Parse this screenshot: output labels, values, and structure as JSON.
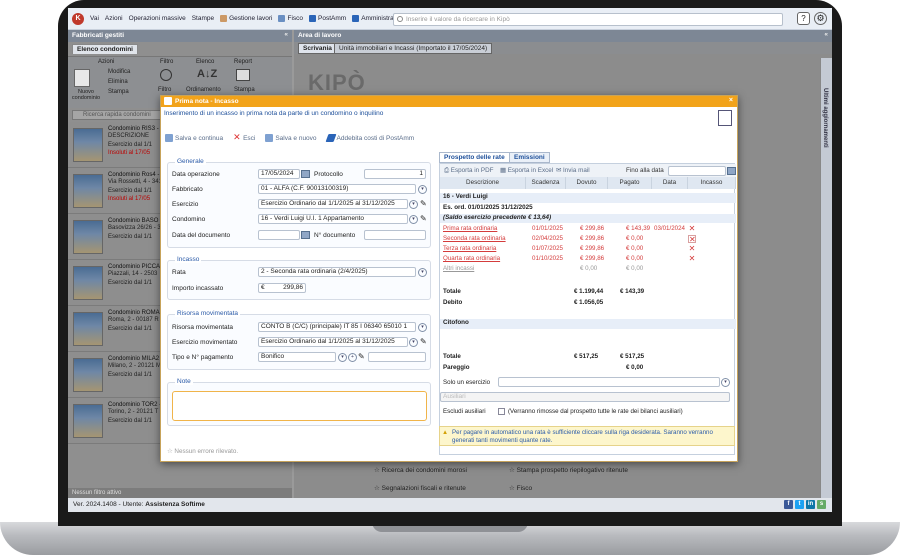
{
  "topbar": {
    "menu": [
      {
        "label": "Vai",
        "icon": "menu-icon"
      },
      {
        "label": "Azioni",
        "icon": "actions-icon"
      },
      {
        "label": "Operazioni massive",
        "icon": "bulk-icon"
      },
      {
        "label": "Stampe",
        "icon": "print-icon"
      },
      {
        "label": "Gestione lavori",
        "icon": "tools-icon"
      },
      {
        "label": "Fisco",
        "icon": "tax-icon"
      },
      {
        "label": "PostAmm",
        "icon": "postamm-icon"
      },
      {
        "label": "Amministrare.com",
        "icon": "web-icon"
      }
    ],
    "search_placeholder": "Inserire il valore da ricercare in Kipò",
    "help": "?",
    "settings": "⚙"
  },
  "left": {
    "title": "Fabbricati gestiti",
    "collapse": "«",
    "tab": "Elenco condomini",
    "toolbar": {
      "azioni": "Azioni",
      "nuovo": "Nuovo condominio",
      "modifica": "Modifica",
      "elimina": "Elimina",
      "stampa": "Stampa",
      "filtro": "Filtro",
      "filtro_btn": "Filtro",
      "elenco": "Elenco",
      "ordinamento": "Ordinamento",
      "report": "Report",
      "stampa_report": "Stampa"
    },
    "search_placeholder": "Ricerca rapida condomini",
    "condos": [
      {
        "name": "Condominio RIS3 -",
        "addr": "DESCRIZIONE",
        "extra": "Via Remondo, 3 - 2",
        "extra2": "C.F. 00843430023",
        "ex": "Esercizio dal 1/1",
        "ins": "Insoluti al 17/05"
      },
      {
        "name": "Condominio Ros4 -",
        "addr": "Via Rossetti, 4 - 341",
        "ex": "Esercizio dal 1/1",
        "ins": "Insoluti al 17/05"
      },
      {
        "name": "Condominio BASO",
        "addr": "Basovizza 26/26 - 3",
        "ex": "Esercizio dal 1/1",
        "ins": ""
      },
      {
        "name": "Condominio PICCA",
        "addr": "Piazzali, 14 - 2503",
        "ex": "Esercizio dal 1/1",
        "ins": ""
      },
      {
        "name": "Condominio ROMA",
        "addr": "Roma, 2 - 00187 R",
        "ex": "Esercizio dal 1/1",
        "ins": ""
      },
      {
        "name": "Condominio MILA2",
        "addr": "Milano, 2 - 20121 M",
        "ex": "Esercizio dal 1/1",
        "ins": ""
      },
      {
        "name": "Condominio TOR2 -",
        "addr": "Torino, 2 - 20121 T",
        "ex": "Esercizio dal 1/1",
        "ins": ""
      }
    ],
    "footer": "Nessun filtro attivo"
  },
  "work": {
    "title": "Area di lavoro",
    "collapse": "«",
    "tab1": "Scrivania",
    "tab2": "Unità immobiliari e Incassi (Importato il 17/05/2024)",
    "watermark": "KIPÒ",
    "vertical": "Ultimi aggiornamenti",
    "links": [
      "Ricerca dei condomini morosi",
      "Stampa prospetto riepilogativo ritenute",
      "Segnalazioni fiscali e ritenute",
      "Fisco"
    ]
  },
  "dialog": {
    "title": "Prima nota - Incasso",
    "close": "×",
    "subtitle": "Inserimento di un incasso in prima nota da parte di un condomino o inquilino",
    "actions": {
      "save_continue": "Salva e continua",
      "exit": "Esci",
      "save_new": "Salva e nuovo",
      "postamm": "Addebita costi di PostAmm"
    },
    "generale": {
      "legend": "Generale",
      "data_label": "Data operazione",
      "data_value": "17/05/2024",
      "protocollo_label": "Protocollo",
      "protocollo_value": "1",
      "fabbricato_label": "Fabbricato",
      "fabbricato_value": "01 - ALFA (C.F. 90013100319)",
      "esercizio_label": "Esercizio",
      "esercizio_value": "Esercizio Ordinario dal 1/1/2025 al 31/12/2025",
      "condominio_label": "Condomino",
      "condominio_value": "16 - Verdi Luigi U.I. 1 Appartamento",
      "datadoc_label": "Data del documento",
      "ndoc_label": "N° documento"
    },
    "incasso": {
      "legend": "Incasso",
      "rata_label": "Rata",
      "rata_value": "2 - Seconda rata ordinaria (2/4/2025)",
      "importo_label": "Importo incassato",
      "importo_currency": "€",
      "importo_value": "299,86"
    },
    "risorsa": {
      "legend": "Risorsa movimentata",
      "risorsa_label": "Risorsa movimentata",
      "risorsa_value": "CONTO B (C/C) (principale) IT 85 I 06340 65010 1",
      "esercizio_label": "Esercizio movimentato",
      "esercizio_value": "Esercizio Ordinario dal 1/1/2025 al 31/12/2025",
      "tipo_label": "Tipo e N° pagamento",
      "tipo_value": "Bonifico"
    },
    "note_legend": "Note",
    "footer": "Nessun errore rilevato.",
    "right": {
      "tab1": "Prospetto delle rate",
      "tab2": "Emissioni",
      "pdf": "Esporta in PDF",
      "excel": "Esporta in Excel",
      "mail": "Invia mail",
      "fino": "Fino alla data",
      "headers": [
        "Descrizione",
        "Scadenza",
        "Dovuto",
        "Pagato",
        "Data",
        "Incasso"
      ],
      "group1": "16 - Verdi Luigi",
      "group1b": "Es. ord. 01/01/2025 31/12/2025",
      "saldo": "(Saldo esercizio precedente € 13,64)",
      "rows": [
        {
          "desc": "Prima rata ordinaria",
          "scad": "01/01/2025",
          "dov": "€ 299,86",
          "pag": "€ 143,39",
          "data": "03/01/2024",
          "cls": "red"
        },
        {
          "desc": "Seconda rata ordinaria",
          "scad": "02/04/2025",
          "dov": "€ 299,86",
          "pag": "€ 0,00",
          "data": "",
          "cls": "red"
        },
        {
          "desc": "Terza rata ordinaria",
          "scad": "01/07/2025",
          "dov": "€ 299,86",
          "pag": "€ 0,00",
          "data": "",
          "cls": "red"
        },
        {
          "desc": "Quarta rata ordinaria",
          "scad": "01/10/2025",
          "dov": "€ 299,86",
          "pag": "€ 0,00",
          "data": "",
          "cls": "red"
        },
        {
          "desc": "Altri incassi",
          "scad": "",
          "dov": "€ 0,00",
          "pag": "€ 0,00",
          "data": "",
          "cls": "grey"
        }
      ],
      "totale_label": "Totale",
      "totale_dov": "€ 1.199,44",
      "totale_pag": "€ 143,39",
      "debito_label": "Debito",
      "debito_val": "€ 1.056,05",
      "group2": "Citofono",
      "totale2_label": "Totale",
      "totale2_dov": "€ 517,25",
      "totale2_pag": "€ 517,25",
      "pareggio_label": "Pareggio",
      "pareggio_val": "€ 0,00",
      "solo_label": "Solo un esercizio",
      "ausiliari": "Ausiliari",
      "escludi_label": "Escludi ausiliari",
      "escludi_text": "(Verranno rimosse dal prospetto tutte le rate dei bilanci ausiliari)",
      "note": "Per pagare in automatico una rata è sufficiente cliccare sulla riga desiderata. Saranno verranno generati tanti movimenti quante rate."
    }
  },
  "status": {
    "version": "Ver. 2024.1408  -  Utente:",
    "user": "Assistenza Softime"
  }
}
